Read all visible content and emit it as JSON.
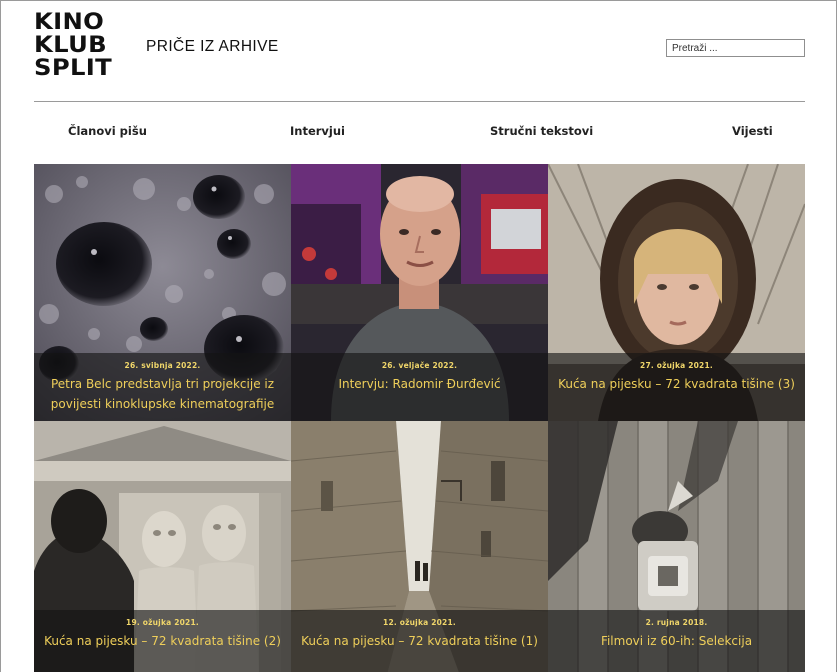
{
  "header": {
    "logo_lines": [
      "KINO",
      "KLUB",
      "SPLIT"
    ],
    "site_title": "PRIČE IZ ARHIVE",
    "search_placeholder": "Pretraži ..."
  },
  "nav": {
    "items": [
      {
        "label": "Članovi pišu"
      },
      {
        "label": "Intervjui"
      },
      {
        "label": "Stručni tekstovi"
      },
      {
        "label": "Vijesti"
      }
    ]
  },
  "posts": [
    {
      "date": "26. svibnja 2022.",
      "title": "Petra Belc predstavlja tri projekcije iz povijesti kinoklupske kinematografije",
      "image": "bubbles-closeup"
    },
    {
      "date": "26. veljače 2022.",
      "title": "Intervju: Radomir Đurđević",
      "image": "portrait-older-man"
    },
    {
      "date": "27. ožujka 2021.",
      "title": "Kuća na pijesku – 72 kvadrata tišine (3)",
      "image": "girl-in-hood"
    },
    {
      "date": "19. ožujka 2021.",
      "title": "Kuća na pijesku – 72 kvadrata tišine (2)",
      "image": "stone-relief"
    },
    {
      "date": "12. ožujka 2021.",
      "title": "Kuća na pijesku – 72 kvadrata tišine (1)",
      "image": "narrow-street"
    },
    {
      "date": "2. rujna 2018.",
      "title": "Filmovi iz 60-ih: Selekcija",
      "image": "wooden-wall-object"
    }
  ],
  "colors": {
    "caption_text": "#efcf5a",
    "caption_bg": "#141414",
    "rule": "#9a9a9a"
  }
}
